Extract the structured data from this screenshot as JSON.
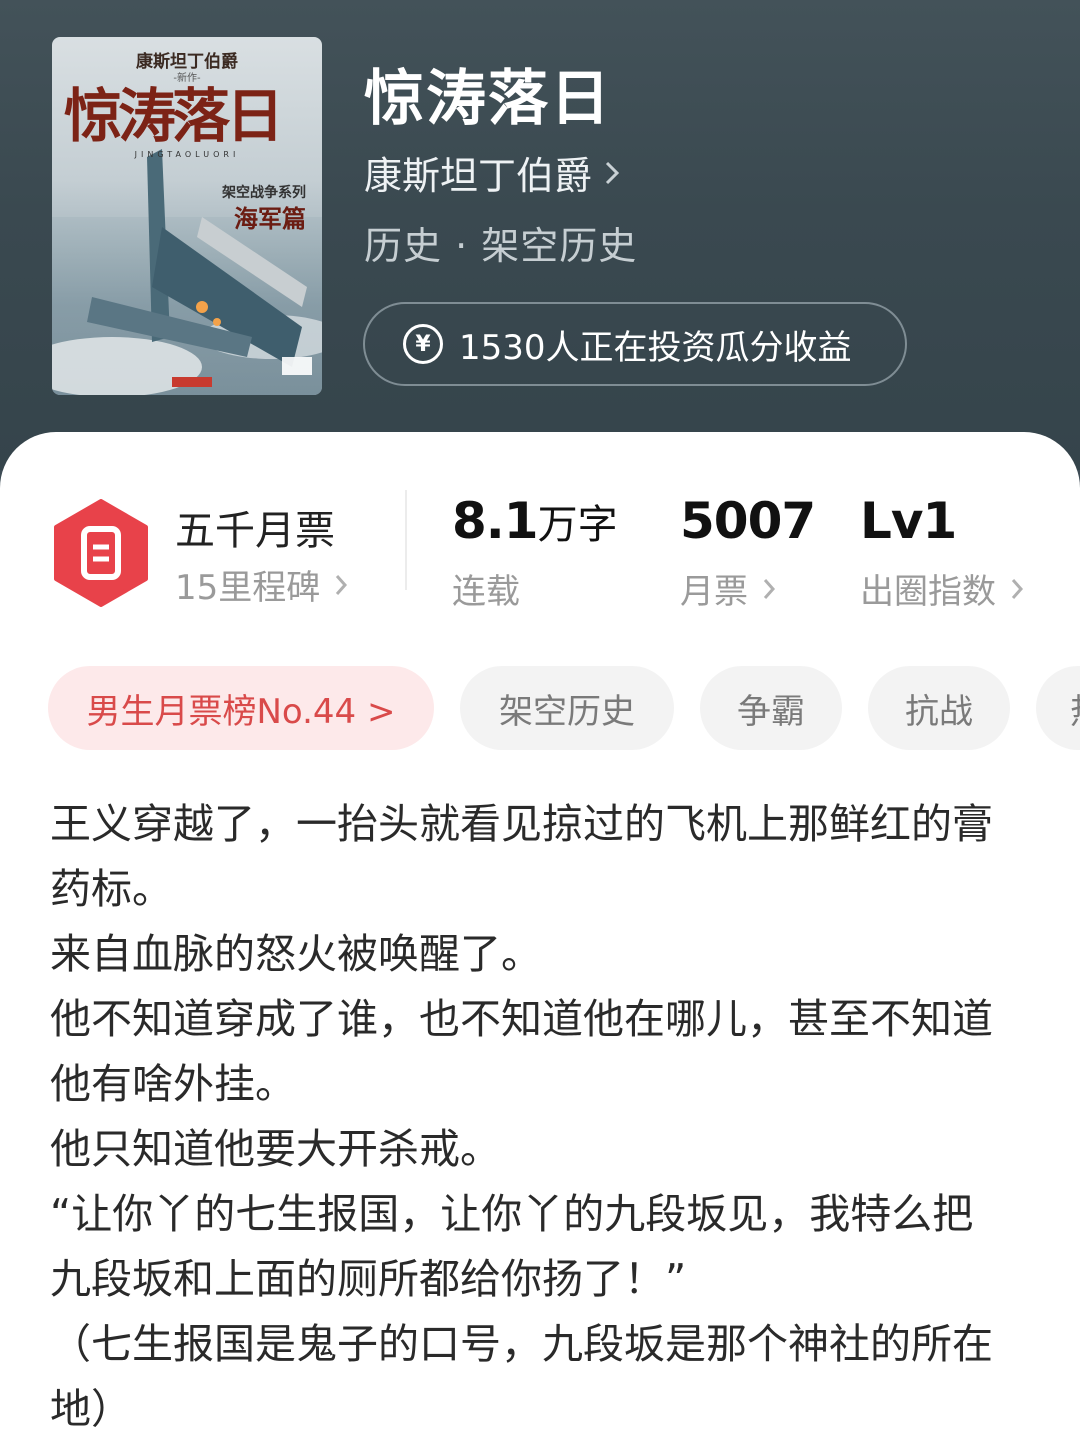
{
  "book": {
    "title": "惊涛落日",
    "author": "康斯坦丁伯爵",
    "genre": "历史 · 架空历史",
    "invest_text": "1530人正在投资瓜分收益"
  },
  "cover": {
    "author": "康斯坦丁伯爵",
    "new_work": "-新作-",
    "title": "惊涛落日",
    "pinyin": "JINGTAOLUORI",
    "series": "架空战争系列",
    "subtitle": "海军篇"
  },
  "stats": {
    "ticket": {
      "title": "五千月票",
      "sub": "15里程碑"
    },
    "words": {
      "value": "8.1",
      "unit": "万字",
      "label": "连载"
    },
    "monthly": {
      "value": "5007",
      "label": "月票"
    },
    "circle": {
      "value": "Lv1",
      "label": "出圈指数"
    }
  },
  "tags": [
    "男生月票榜No.44 >",
    "架空历史",
    "争霸",
    "抗战",
    "热"
  ],
  "synopsis": [
    "王义穿越了，一抬头就看见掠过的飞机上那鲜红的膏药标。",
    "来自血脉的怒火被唤醒了。",
    "他不知道穿成了谁，也不知道他在哪儿，甚至不知道他有啥外挂。",
    "他只知道他要大开杀戒。",
    "“让你丫的七生报国，让你丫的九段坂见，我特么把九段坂和上面的厕所都给你扬了！”",
    "（七生报国是鬼子的口号，九段坂是那个神社的所在地）"
  ],
  "colors": {
    "header_bg": "#3a4950",
    "accent_red": "#e8424a",
    "rank_tag_bg": "#fde9ea",
    "rank_tag_text": "#d94a4a"
  },
  "icons": {
    "invest": "yen-circle-icon",
    "ticket": "ticket-hexagon-icon",
    "chevron": "chevron-right-icon"
  }
}
